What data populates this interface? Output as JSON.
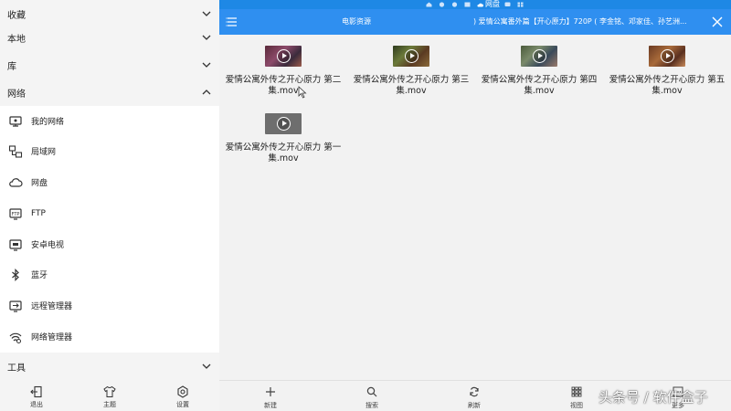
{
  "sidebar": {
    "sections": {
      "favorites": "收藏",
      "local": "本地",
      "library": "库",
      "network": "网络",
      "tools": "工具"
    },
    "network_items": [
      {
        "label": "我的网络",
        "icon": "my-network-icon"
      },
      {
        "label": "局域网",
        "icon": "lan-icon"
      },
      {
        "label": "网盘",
        "icon": "cloud-icon"
      },
      {
        "label": "FTP",
        "icon": "ftp-icon"
      },
      {
        "label": "安卓电视",
        "icon": "tv-icon"
      },
      {
        "label": "蓝牙",
        "icon": "bluetooth-icon"
      },
      {
        "label": "远程管理器",
        "icon": "remote-manager-icon"
      },
      {
        "label": "网络管理器",
        "icon": "wifi-manager-icon"
      }
    ],
    "footer": {
      "exit": "退出",
      "theme": "主题",
      "settings": "设置"
    }
  },
  "statusbar": {
    "label": "网盘"
  },
  "toolbar": {
    "title": "电影资源",
    "path": ") 爱情公寓番外篇【开心原力】720P ( 李金铭、邓家佳、孙艺洲..."
  },
  "files": [
    {
      "name": "爱情公寓外传之开心原力 第二集.mov"
    },
    {
      "name": "爱情公寓外传之开心原力 第三集.mov"
    },
    {
      "name": "爱情公寓外传之开心原力 第四集.mov"
    },
    {
      "name": "爱情公寓外传之开心原力 第五集.mov"
    },
    {
      "name": "爱情公寓外传之开心原力 第一集.mov"
    }
  ],
  "bottombar": {
    "new": "新建",
    "search": "搜索",
    "refresh": "刷新",
    "view": "视图",
    "more": "更多"
  },
  "watermark": "头条号 / 软件盒子",
  "colors": {
    "accent": "#2f8ff0",
    "statusbar": "#1e88e5",
    "sidebar_bg": "#f4f4f4",
    "content_bg": "#f2f2f2"
  }
}
